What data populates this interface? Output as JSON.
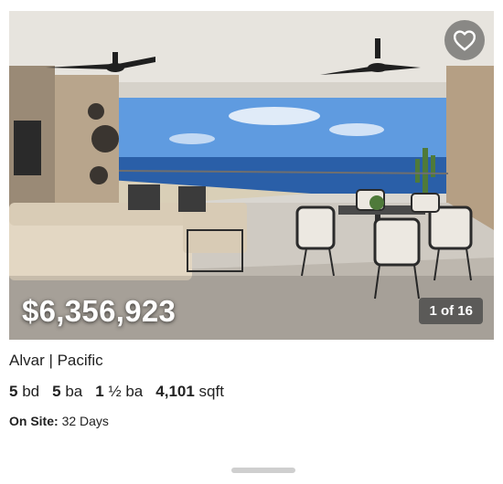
{
  "listing": {
    "price": "$6,356,923",
    "photo_counter": "1 of 16",
    "name": "Alvar | Pacific",
    "beds_value": "5",
    "beds_unit": "bd",
    "baths_value": "5",
    "baths_unit": "ba",
    "half_baths_value": "1",
    "half_baths_unit": "½ ba",
    "sqft_value": "4,101",
    "sqft_unit": "sqft",
    "on_site_label": "On Site:",
    "on_site_value": "32 Days"
  },
  "icons": {
    "favorite": "heart-outline-icon"
  }
}
